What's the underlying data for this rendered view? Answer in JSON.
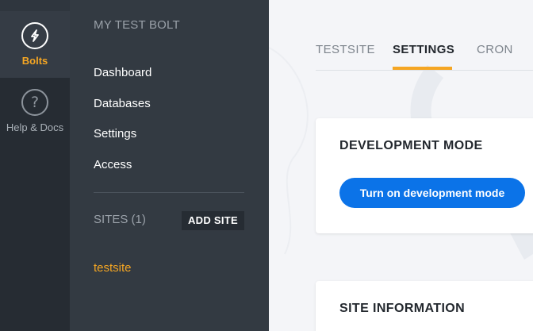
{
  "rail": {
    "items": [
      {
        "label": "Bolts",
        "icon": "bolt-icon",
        "active": true
      },
      {
        "label": "Help & Docs",
        "icon": "help-icon",
        "active": false
      }
    ]
  },
  "panel": {
    "title": "MY TEST BOLT",
    "nav": [
      "Dashboard",
      "Databases",
      "Settings",
      "Access"
    ],
    "sites_label": "SITES (1)",
    "add_site_label": "ADD SITE",
    "sites": [
      "testsite"
    ]
  },
  "main": {
    "tabs": [
      {
        "label": "TESTSITE",
        "active": false
      },
      {
        "label": "SETTINGS",
        "active": true
      },
      {
        "label": "CRON",
        "active": false
      }
    ],
    "dev_card": {
      "title": "DEVELOPMENT MODE",
      "button_label": "Turn on development mode"
    },
    "info_card": {
      "title": "SITE INFORMATION"
    }
  },
  "colors": {
    "accent": "#f5a623",
    "primary_button": "#0b73e8",
    "rail_bg": "#262c33",
    "panel_bg": "#333a42"
  }
}
